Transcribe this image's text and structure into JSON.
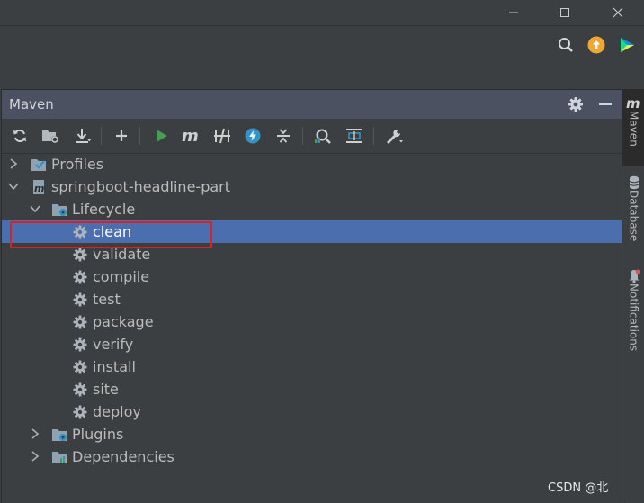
{
  "window": {
    "controls": [
      "minimize-icon",
      "maximize-icon",
      "close-icon"
    ]
  },
  "topbar": {
    "icons": [
      "search-icon",
      "update-icon",
      "jetbrains-toolbox-icon"
    ]
  },
  "panel": {
    "title": "Maven",
    "header_icons": [
      "gear-icon",
      "minimize-panel-icon"
    ],
    "toolbar": [
      "reload-icon",
      "generate-sources-icon",
      "download-icon",
      "add-icon",
      "run-icon",
      "maven-goal-icon",
      "toggle-offline-icon",
      "skip-tests-icon",
      "collapse-all-icon",
      "analyze-dependencies-icon",
      "show-diagram-icon",
      "settings-wrench-icon"
    ]
  },
  "tree": {
    "profiles": "Profiles",
    "project": "springboot-headline-part",
    "lifecycle": "Lifecycle",
    "goals": [
      "clean",
      "validate",
      "compile",
      "test",
      "package",
      "verify",
      "install",
      "site",
      "deploy"
    ],
    "selected_goal": "clean",
    "plugins": "Plugins",
    "dependencies": "Dependencies"
  },
  "rightbar": {
    "tabs": [
      "Maven",
      "Database",
      "Notifications"
    ]
  },
  "watermark": "CSDN @北",
  "colors": {
    "selection": "#4b6eaf",
    "header": "#4b5161",
    "highlight_box": "#e02020",
    "run_green": "#499c54",
    "update_orange": "#f0a732"
  }
}
